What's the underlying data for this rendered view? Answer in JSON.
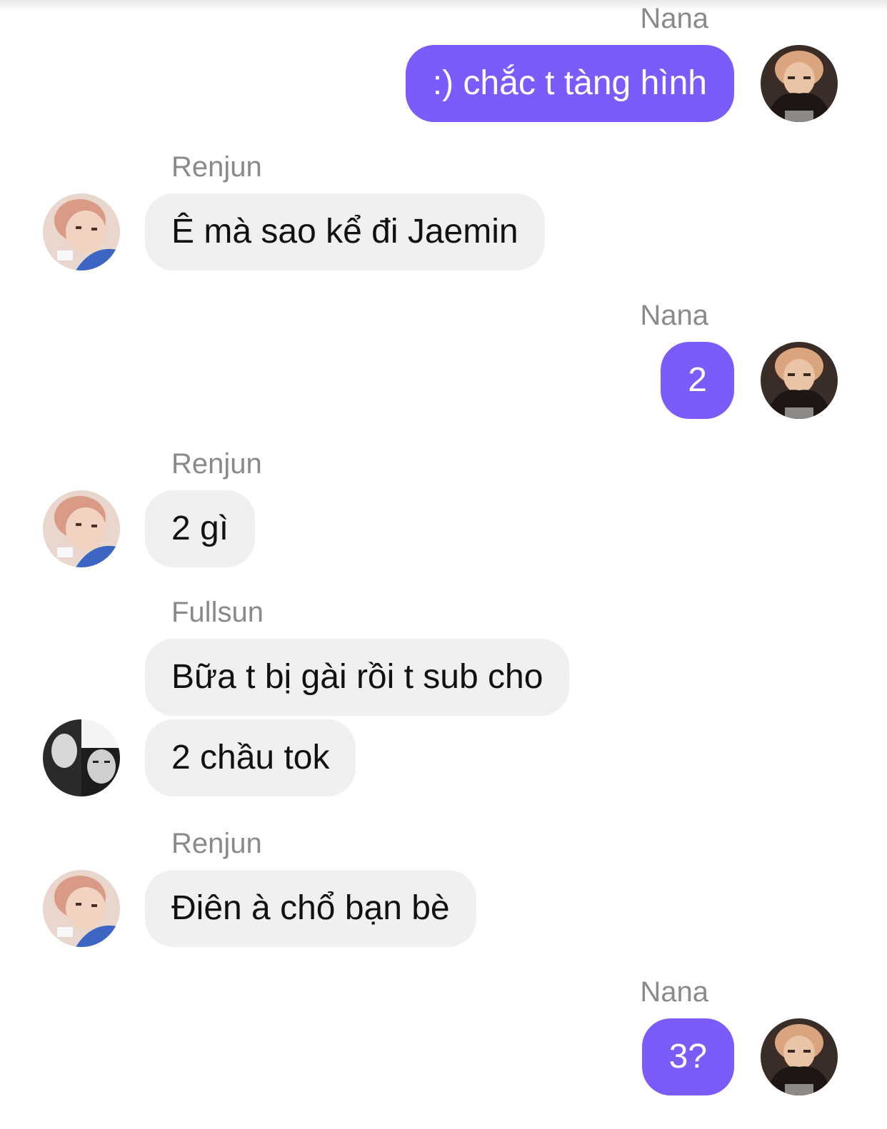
{
  "messages": [
    {
      "sender": "Nana",
      "text": ":) chắc t tàng hình"
    },
    {
      "sender": "Renjun",
      "text": "Ê mà sao kể đi Jaemin"
    },
    {
      "sender": "Nana",
      "text": "2"
    },
    {
      "sender": "Renjun",
      "text": "2 gì"
    },
    {
      "sender": "Fullsun",
      "text": "Bữa t bị gài rồi t sub cho"
    },
    {
      "text": "2 chầu tok"
    },
    {
      "sender": "Renjun",
      "text": "Điên à chổ bạn bè"
    },
    {
      "sender": "Nana",
      "text": "3?"
    }
  ],
  "colors": {
    "outgoing_bubble": "#7b5cfb",
    "incoming_bubble": "#f0f0f0",
    "sender_name": "#8a8a8e"
  },
  "avatars": {
    "nana": "user-photo-avatar",
    "renjun": "user-photo-avatar",
    "fullsun": "user-photo-avatar"
  }
}
